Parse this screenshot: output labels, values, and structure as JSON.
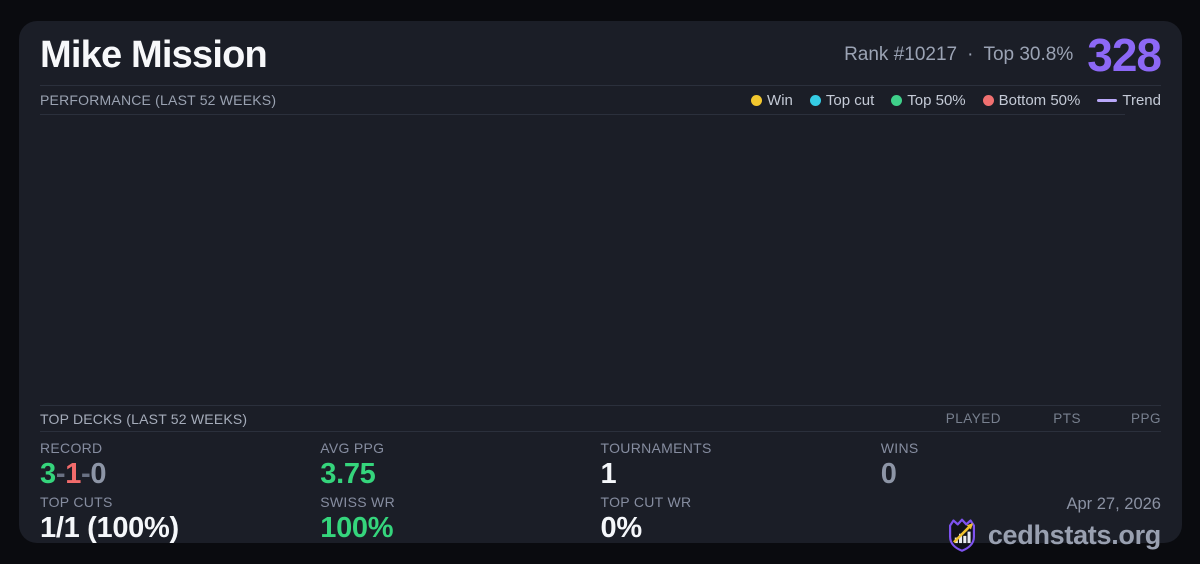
{
  "colors": {
    "accent": "#8c68f6",
    "green": "#35d57c",
    "red": "#f16b6b",
    "gray": "#8d95a6",
    "dim": "#697183",
    "white": "#f5f7fa"
  },
  "header": {
    "title": "Mike Mission",
    "rank": "Rank #10217",
    "separator": "·",
    "top_percent": "Top 30.8%",
    "points": "328"
  },
  "performance": {
    "section_title": "PERFORMANCE (LAST 52 WEEKS)",
    "legend": [
      {
        "label": "Win",
        "color": "#f2c72e",
        "type": "dot"
      },
      {
        "label": "Top cut",
        "color": "#35cce4",
        "type": "dot"
      },
      {
        "label": "Top 50%",
        "color": "#3fd08a",
        "type": "dot"
      },
      {
        "label": "Bottom 50%",
        "color": "#f07070",
        "type": "dot"
      },
      {
        "label": "Trend",
        "color": "#b9a8f9",
        "type": "line"
      }
    ]
  },
  "chart_data": {
    "type": "scatter",
    "title": "PERFORMANCE (LAST 52 WEEKS)",
    "legend": [
      "Win",
      "Top cut",
      "Top 50%",
      "Bottom 50%",
      "Trend"
    ],
    "legend_position": "top-right",
    "grid": false,
    "series": []
  },
  "top_decks": {
    "section_title": "TOP DECKS (LAST 52 WEEKS)",
    "columns": [
      "PLAYED",
      "PTS",
      "PPG"
    ],
    "rows": []
  },
  "stats": {
    "record": {
      "label": "RECORD",
      "wins": "3",
      "losses": "1",
      "draws": "0",
      "separator": "-"
    },
    "avg_ppg": {
      "label": "AVG PPG",
      "value": "3.75"
    },
    "tournaments": {
      "label": "TOURNAMENTS",
      "value": "1"
    },
    "wins": {
      "label": "WINS",
      "value": "0"
    },
    "top_cuts": {
      "label": "TOP CUTS",
      "value": "1/1 (100%)"
    },
    "swiss_wr": {
      "label": "SWISS WR",
      "value": "100%"
    },
    "top_cut_wr": {
      "label": "TOP CUT WR",
      "value": "0%"
    }
  },
  "footer": {
    "date": "Apr 27, 2026",
    "brand": "cedhstats.org"
  }
}
